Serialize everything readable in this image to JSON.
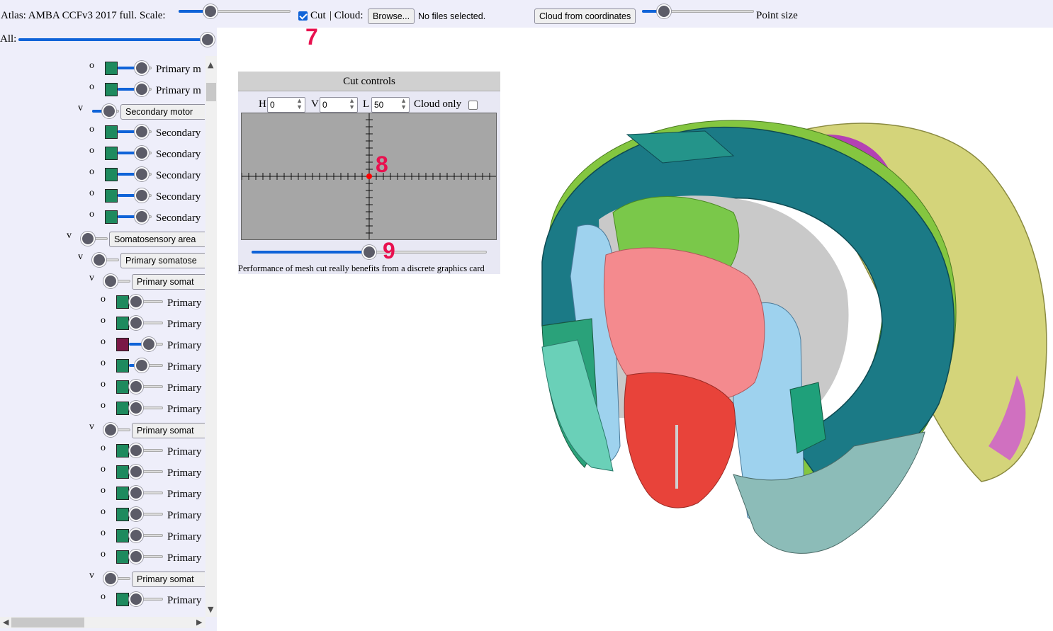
{
  "topbar": {
    "atlas_label": "Atlas: AMBA CCFv3 2017 full. Scale:",
    "cut_label": "Cut",
    "cloud_label": "| Cloud:",
    "browse_label": "Browse...",
    "file_status": "No files selected.",
    "cloud_coords_label": "Cloud from coordinates",
    "point_size_label": "Point size",
    "scale_level": 0.25,
    "point_size_level": 0.15,
    "cut_checked": true
  },
  "all": {
    "label": "All:",
    "level": 1.0
  },
  "annotations": {
    "a7": "7",
    "a8": "8",
    "a9": "9"
  },
  "tree": [
    {
      "bullet": "o",
      "label": "Primary m",
      "swatch": "#1e8a5e",
      "level": 0.85
    },
    {
      "bullet": "o",
      "label": "Primary m",
      "swatch": "#1e8a5e",
      "level": 0.85
    },
    {
      "bullet": "v",
      "label": "Secondary motor",
      "button": true,
      "level": 0.8
    },
    {
      "bullet": "o",
      "label": "Secondary",
      "swatch": "#1e8a5e",
      "level": 0.85
    },
    {
      "bullet": "o",
      "label": "Secondary",
      "swatch": "#1e8a5e",
      "level": 0.85
    },
    {
      "bullet": "o",
      "label": "Secondary",
      "swatch": "#1e8a5e",
      "level": 0.85
    },
    {
      "bullet": "o",
      "label": "Secondary",
      "swatch": "#1e8a5e",
      "level": 0.85
    },
    {
      "bullet": "o",
      "label": "Secondary",
      "swatch": "#1e8a5e",
      "level": 0.85
    },
    {
      "bullet": "v",
      "label": "Somatosensory area",
      "button": true,
      "level": 0.0
    },
    {
      "bullet": "v",
      "label": "Primary somatose",
      "button": true,
      "level": 0.0
    },
    {
      "bullet": "v",
      "label": "Primary somat",
      "button": true,
      "level": 0.0
    },
    {
      "bullet": "o",
      "label": "Primary",
      "swatch": "#1e8a5e",
      "level": 0.0
    },
    {
      "bullet": "o",
      "label": "Primary",
      "swatch": "#1e8a5e",
      "level": 0.0
    },
    {
      "bullet": "o",
      "label": "Primary",
      "swatch": "#7a1846",
      "level": 0.65
    },
    {
      "bullet": "o",
      "label": "Primary",
      "swatch": "#1e8a5e",
      "level": 0.3
    },
    {
      "bullet": "o",
      "label": "Primary",
      "swatch": "#1e8a5e",
      "level": 0.0
    },
    {
      "bullet": "o",
      "label": "Primary",
      "swatch": "#1e8a5e",
      "level": 0.0
    },
    {
      "bullet": "v",
      "label": "Primary somat",
      "button": true,
      "level": 0.0
    },
    {
      "bullet": "o",
      "label": "Primary",
      "swatch": "#1e8a5e",
      "level": 0.0
    },
    {
      "bullet": "o",
      "label": "Primary",
      "swatch": "#1e8a5e",
      "level": 0.0
    },
    {
      "bullet": "o",
      "label": "Primary",
      "swatch": "#1e8a5e",
      "level": 0.0
    },
    {
      "bullet": "o",
      "label": "Primary",
      "swatch": "#1e8a5e",
      "level": 0.0
    },
    {
      "bullet": "o",
      "label": "Primary",
      "swatch": "#1e8a5e",
      "level": 0.0
    },
    {
      "bullet": "o",
      "label": "Primary",
      "swatch": "#1e8a5e",
      "level": 0.0
    },
    {
      "bullet": "v",
      "label": "Primary somat",
      "button": true,
      "level": 0.0
    },
    {
      "bullet": "o",
      "label": "Primary",
      "swatch": "#1e8a5e",
      "level": 0.0
    }
  ],
  "cut": {
    "title": "Cut controls",
    "h_label": "H",
    "h_value": "0",
    "v_label": "V",
    "v_value": "0",
    "l_label": "L",
    "l_value": "50",
    "cloud_only_label": "Cloud only",
    "cloud_only_checked": false,
    "slider_level": 0.5,
    "note": "Performance of mesh cut really benefits from a discrete graphics card"
  },
  "colors": {
    "accent": "#0f63d8",
    "panel_bg": "#eeeefa",
    "annotation": "#e8114f",
    "brain_teal": "#1b7a86",
    "brain_yellow": "#d4d47a",
    "brain_green": "#7ac84a",
    "brain_pink": "#f48a8e",
    "brain_red": "#e8433a",
    "brain_lightblue": "#9ed2ee"
  }
}
